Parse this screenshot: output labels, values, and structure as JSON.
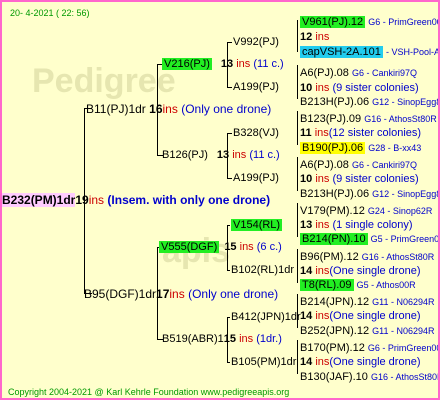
{
  "header": {
    "date": "20- 4-2021 ( 22: 56)"
  },
  "watermark": {
    "line1": "Pedigree",
    "line2": "apis"
  },
  "root": {
    "id": "B232(PM)1dr",
    "count": "19",
    "ins": "ins",
    "note": "(Insem. with only one drone)"
  },
  "gen1": [
    {
      "id": "B11(PJ)1dr",
      "count": "16",
      "ins": "ins",
      "note": "(Only one drone)"
    },
    {
      "id": "B95(DGF)1dr",
      "count": "17",
      "ins": "ins",
      "note": "(Only one drone)"
    }
  ],
  "gen2": [
    {
      "id": "V216(PJ)",
      "count": "13",
      "ins": "ins",
      "note": "(11 c.)"
    },
    {
      "id": "B126(PJ)",
      "count": "13",
      "ins": "ins",
      "note": "(11 c.)"
    },
    {
      "id": "V555(DGF)",
      "count": "15",
      "ins": "ins",
      "note": "(6 c.)"
    },
    {
      "id": "B519(ABR)1",
      "count": "15",
      "ins": "ins",
      "note": "(1dr.)"
    }
  ],
  "gen3": [
    {
      "id": "V992(PJ)"
    },
    {
      "id": "A199(PJ)"
    },
    {
      "id": "B328(VJ)"
    },
    {
      "id": "A199(PJ)"
    },
    {
      "id": "V154(RL)"
    },
    {
      "id": "B102(RL)1dr"
    },
    {
      "id": "B412(JPN)1dr"
    },
    {
      "id": "B105(PM)1dr"
    }
  ],
  "gen3counts": [
    {
      "count": "",
      "ins": "",
      "note": ""
    },
    {
      "count": "",
      "ins": "",
      "note": ""
    },
    {
      "count": "",
      "ins": "",
      "note": ""
    },
    {
      "count": "",
      "ins": "",
      "note": ""
    }
  ],
  "gen4": [
    {
      "id": "V961(PJ).12",
      "info": "G6 - PrimGreen00",
      "count": "12",
      "ins": "ins"
    },
    {
      "id": "capVSH-2A.101",
      "info": "- VSH-Pool-AR"
    },
    {
      "id": "A6(PJ).08",
      "info": "G6 - Cankiri97Q",
      "count": "10",
      "ins": "ins",
      "note": "(9 sister colonies)"
    },
    {
      "id": "B213H(PJ).06",
      "info": "G12 - SinopEgg86R"
    },
    {
      "id": "B123(PJ).09",
      "info": "G16 - AthosSt80R",
      "count": "11",
      "ins": "ins",
      "note": "(12 sister colonies)"
    },
    {
      "id": "B190(PJ).06",
      "info": "G28 - B-xx43"
    },
    {
      "id": "A6(PJ).08",
      "info": "G6 - Cankiri97Q",
      "count": "10",
      "ins": "ins",
      "note": "(9 sister colonies)"
    },
    {
      "id": "B213H(PJ).06",
      "info": "G12 - SinopEgg86R"
    },
    {
      "id": "V179(PM).12",
      "info": "G24 - Sinop62R",
      "count": "13",
      "ins": "ins",
      "note": "(1 single colony)"
    },
    {
      "id": "B214(PN).10",
      "info": "G5 - PrimGreen00"
    },
    {
      "id": "B96(PM).12",
      "info": "G16 - AthosSt80R",
      "count": "14",
      "ins": "ins",
      "note": "(One single drone)"
    },
    {
      "id": "T8(RL).09",
      "info": "G5 - Athos00R"
    },
    {
      "id": "B214(JPN).12",
      "info": "G11 - N06294R",
      "count": "14",
      "ins": "ins",
      "note": "(One single drone)"
    },
    {
      "id": "B252(JPN).12",
      "info": "G11 - N06294R"
    },
    {
      "id": "B170(PM).12",
      "info": "G6 - PrimGreen00",
      "count": "14",
      "ins": "ins",
      "note": "(One single drone)"
    },
    {
      "id": "B130(JAF).10",
      "info": "G16 - AthosSt80R"
    }
  ],
  "footer": {
    "copyright": "Copyright 2004-2021 @ Karl Kehrle Foundation    www.pedigreeapis.org"
  }
}
